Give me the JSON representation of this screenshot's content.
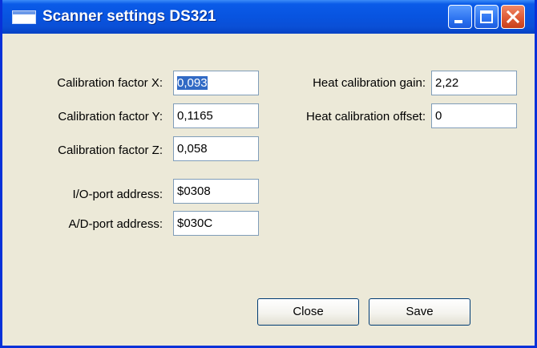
{
  "window": {
    "title": "Scanner settings DS321",
    "icon": "app-window-icon"
  },
  "title_buttons": [
    "minimize-icon",
    "maximize-icon",
    "close-icon"
  ],
  "fields": {
    "cal_x": {
      "label": "Calibration factor X:",
      "value": "0,093",
      "selected": true
    },
    "cal_y": {
      "label": "Calibration factor Y:",
      "value": "0,1165"
    },
    "cal_z": {
      "label": "Calibration factor Z:",
      "value": "0,058"
    },
    "io_port": {
      "label": "I/O-port address:",
      "value": "$0308"
    },
    "ad_port": {
      "label": "A/D-port address:",
      "value": "$030C"
    },
    "heat_gain": {
      "label": "Heat calibration gain:",
      "value": "2,22"
    },
    "heat_offset": {
      "label": "Heat calibration offset:",
      "value": "0"
    }
  },
  "buttons": {
    "close": "Close",
    "save": "Save"
  },
  "colors": {
    "titlebar": "#0A5BE8",
    "selection": "#316AC5",
    "dialog_bg": "#ECE9D8"
  }
}
